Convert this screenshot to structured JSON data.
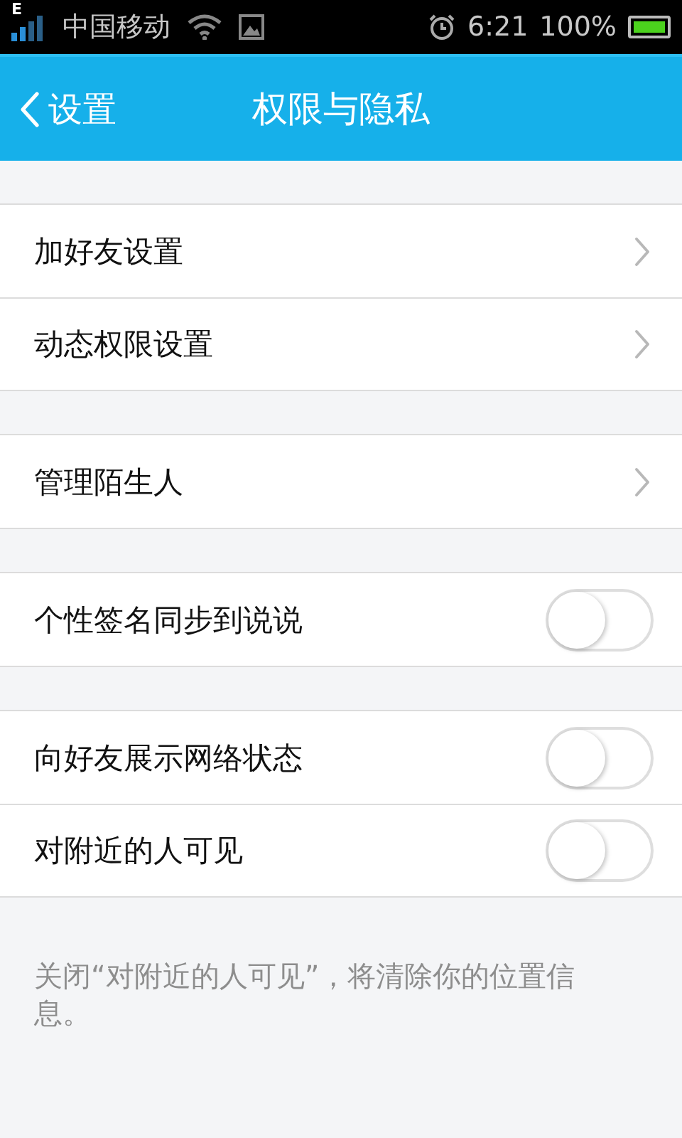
{
  "status_bar": {
    "network_type": "E",
    "carrier": "中国移动",
    "time": "6:21",
    "battery_text": "100%"
  },
  "header": {
    "back_label": "设置",
    "title": "权限与隐私"
  },
  "groups": [
    {
      "items": [
        {
          "kind": "link",
          "label": "加好友设置"
        },
        {
          "kind": "link",
          "label": "动态权限设置"
        }
      ]
    },
    {
      "items": [
        {
          "kind": "link",
          "label": "管理陌生人"
        }
      ]
    },
    {
      "items": [
        {
          "kind": "toggle",
          "label": "个性签名同步到说说",
          "on": false
        }
      ]
    },
    {
      "items": [
        {
          "kind": "toggle",
          "label": "向好友展示网络状态",
          "on": false
        },
        {
          "kind": "toggle",
          "label": "对附近的人可见",
          "on": false
        }
      ]
    }
  ],
  "note": "关闭“对附近的人可见”，将清除你的位置信息。"
}
